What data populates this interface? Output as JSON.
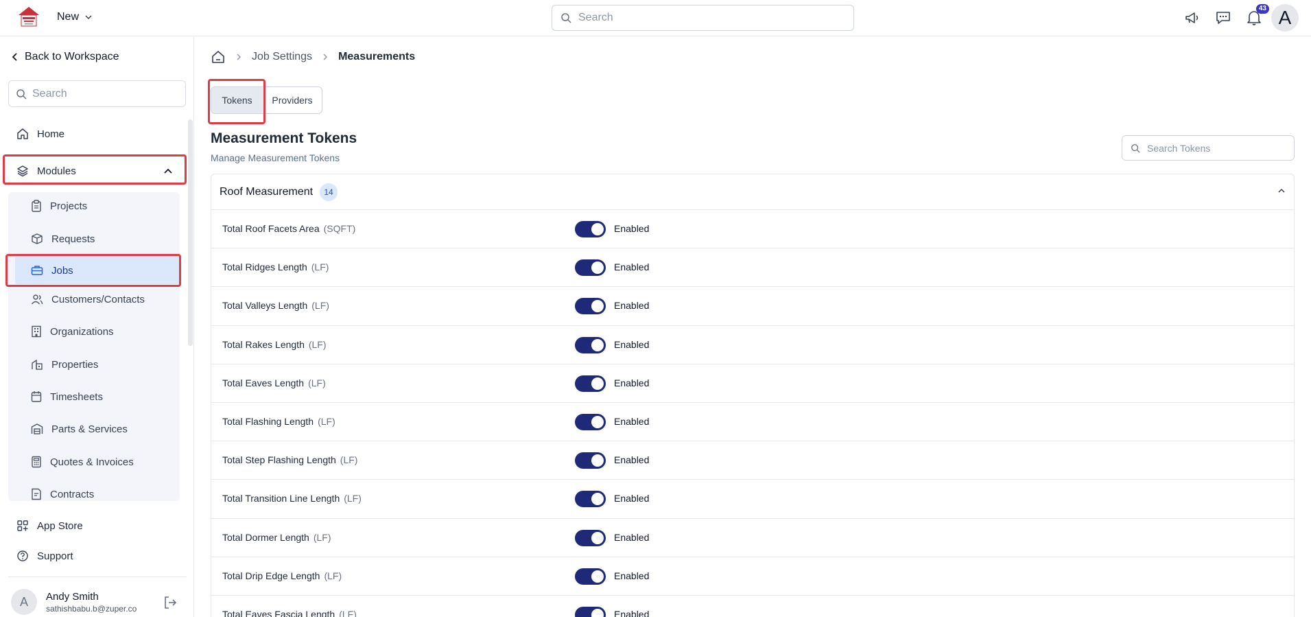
{
  "topbar": {
    "new_label": "New",
    "search_placeholder": "Search",
    "notification_count": "43",
    "avatar_initial": "A"
  },
  "sidebar": {
    "back_label": "Back to Workspace",
    "search_placeholder": "Search",
    "home_label": "Home",
    "modules_label": "Modules",
    "modules_items": [
      {
        "label": "Projects",
        "icon": "clipboard-icon"
      },
      {
        "label": "Requests",
        "icon": "box-icon"
      },
      {
        "label": "Jobs",
        "icon": "briefcase-icon"
      },
      {
        "label": "Customers/Contacts",
        "icon": "users-icon"
      },
      {
        "label": "Organizations",
        "icon": "building-icon"
      },
      {
        "label": "Properties",
        "icon": "property-icon"
      },
      {
        "label": "Timesheets",
        "icon": "calendar-icon"
      },
      {
        "label": "Parts & Services",
        "icon": "warehouse-icon"
      },
      {
        "label": "Quotes & Invoices",
        "icon": "calculator-icon"
      },
      {
        "label": "Contracts",
        "icon": "contract-icon"
      }
    ],
    "app_store_label": "App Store",
    "support_label": "Support",
    "user": {
      "initial": "A",
      "name": "Andy Smith",
      "email": "sathishbabu.b@zuper.co"
    }
  },
  "breadcrumb": {
    "level1": "Job Settings",
    "level2": "Measurements"
  },
  "tabs": {
    "tokens": "Tokens",
    "providers": "Providers"
  },
  "main": {
    "title": "Measurement Tokens",
    "subtitle": "Manage Measurement Tokens",
    "token_search_placeholder": "Search Tokens"
  },
  "card": {
    "title": "Roof Measurement",
    "count": "14",
    "rows": [
      {
        "label": "Total Roof Facets Area",
        "unit": "(SQFT)",
        "status": "Enabled"
      },
      {
        "label": "Total Ridges Length",
        "unit": "(LF)",
        "status": "Enabled"
      },
      {
        "label": "Total Valleys Length",
        "unit": "(LF)",
        "status": "Enabled"
      },
      {
        "label": "Total Rakes Length",
        "unit": "(LF)",
        "status": "Enabled"
      },
      {
        "label": "Total Eaves Length",
        "unit": "(LF)",
        "status": "Enabled"
      },
      {
        "label": "Total Flashing Length",
        "unit": "(LF)",
        "status": "Enabled"
      },
      {
        "label": "Total Step Flashing Length",
        "unit": "(LF)",
        "status": "Enabled"
      },
      {
        "label": "Total Transition Line Length",
        "unit": "(LF)",
        "status": "Enabled"
      },
      {
        "label": "Total Dormer Length",
        "unit": "(LF)",
        "status": "Enabled"
      },
      {
        "label": "Total Drip Edge Length",
        "unit": "(LF)",
        "status": "Enabled"
      },
      {
        "label": "Total Eaves Fascia Length",
        "unit": "(LF)",
        "status": "Enabled"
      }
    ]
  },
  "colors": {
    "accent": "#1e2a78",
    "highlight": "#dc3c45",
    "active_bg": "#dbe7fb"
  }
}
